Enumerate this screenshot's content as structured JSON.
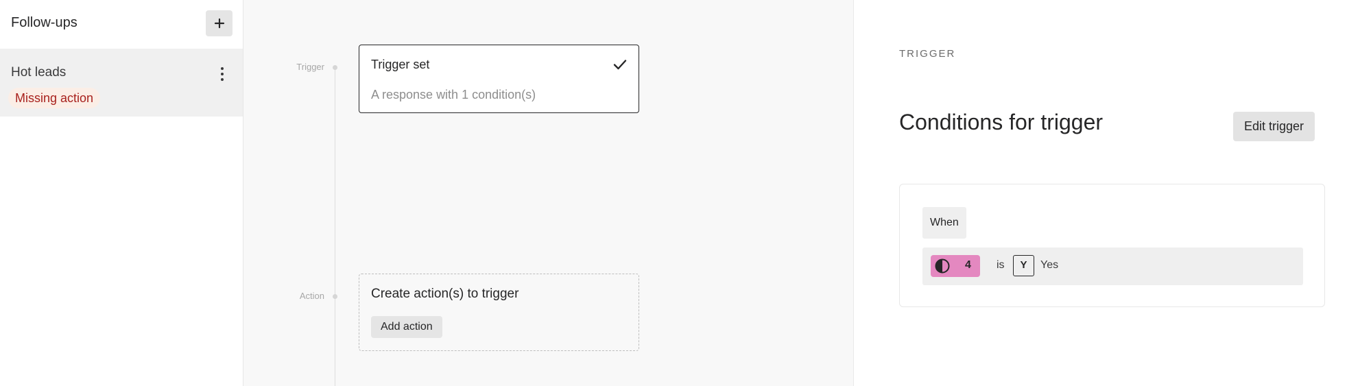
{
  "sidebar": {
    "title": "Follow-ups",
    "add_icon": "plus-icon",
    "items": [
      {
        "name": "Hot leads",
        "badge": "Missing action",
        "menu_icon": "more-vertical-icon"
      }
    ]
  },
  "canvas": {
    "trigger_label": "Trigger",
    "action_label": "Action",
    "trigger_card": {
      "title": "Trigger set",
      "subtitle": "A response with 1 condition(s)",
      "status_icon": "check-icon"
    },
    "action_card": {
      "title": "Create action(s) to trigger",
      "button_label": "Add action"
    }
  },
  "panel": {
    "section_label": "TRIGGER",
    "heading": "Conditions for trigger",
    "edit_button_label": "Edit trigger",
    "condition": {
      "when_label": "When",
      "question_icon": "half-circle-icon",
      "question_number": "4",
      "operator": "is",
      "answer_key": "Y",
      "answer_value": "Yes"
    }
  },
  "colors": {
    "badge_bg": "#fbeee6",
    "badge_text": "#a8211d",
    "question_chip": "#e488c0"
  }
}
